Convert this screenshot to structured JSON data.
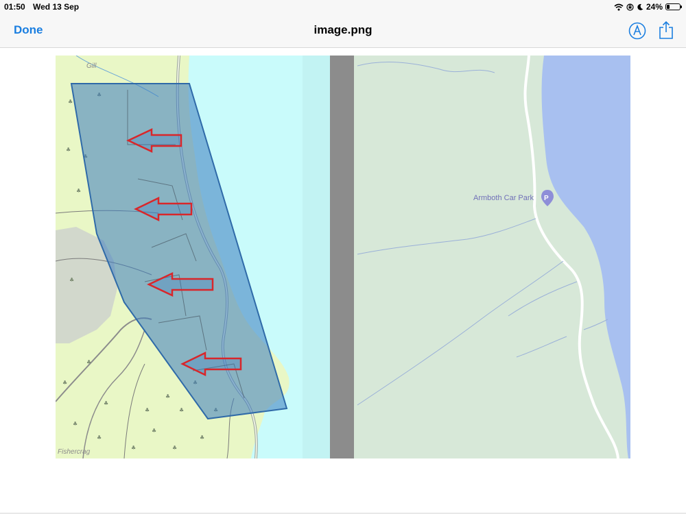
{
  "status_bar": {
    "time": "01:50",
    "date": "Wed 13 Sep",
    "battery_percent": "24%",
    "battery_level": 0.24,
    "icons": [
      "wifi-icon",
      "location-lock-icon",
      "moon-icon",
      "battery-icon"
    ]
  },
  "nav": {
    "done_label": "Done",
    "title": "image.png",
    "markup_icon": "markup-pen-icon",
    "share_icon": "share-icon"
  },
  "map": {
    "left_labels": {
      "gill": "Gill",
      "fishercrag": "Fishercrag"
    },
    "right_labels": {
      "car_park": "Armboth Car Park"
    },
    "colors": {
      "water_left": "#c9fbfb",
      "land_left": "#e9f7c6",
      "overlay": "#3b7bbf",
      "arrow": "#d9262a",
      "divider": "#8c8c8c",
      "land_right": "#d7e8d8",
      "water_right": "#a8c0f0",
      "poi": "#8e8ed8"
    }
  }
}
